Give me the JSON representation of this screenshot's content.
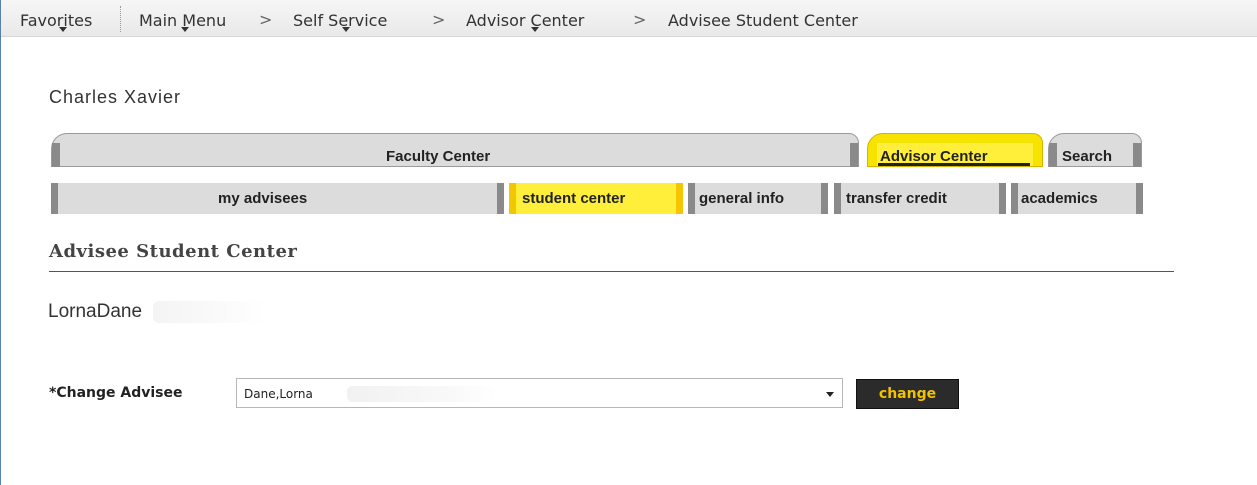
{
  "nav": {
    "favorites": "Favorites",
    "main_menu": "Main Menu",
    "self_service": "Self Service",
    "advisor_center": "Advisor Center",
    "current": "Advisee Student Center",
    "separator": ">"
  },
  "user": {
    "name": "Charles Xavier"
  },
  "tabs": [
    {
      "label": "Faculty Center",
      "active": false
    },
    {
      "label": "Advisor Center",
      "active": true
    },
    {
      "label": "Search",
      "active": false
    }
  ],
  "subtabs": [
    {
      "label": "my advisees",
      "active": false
    },
    {
      "label": "student center",
      "active": true
    },
    {
      "label": "general info",
      "active": false
    },
    {
      "label": "transfer credit",
      "active": false
    },
    {
      "label": "academics",
      "active": false
    }
  ],
  "page": {
    "title": "Advisee Student Center"
  },
  "student": {
    "name": "LornaDane"
  },
  "change_advisee": {
    "label": "*Change Advisee",
    "selected": "Dane,Lorna",
    "button": "change"
  },
  "colors": {
    "active_tab": "#ffef3a",
    "button_bg": "#2b2b2b",
    "button_text": "#f2c200"
  }
}
